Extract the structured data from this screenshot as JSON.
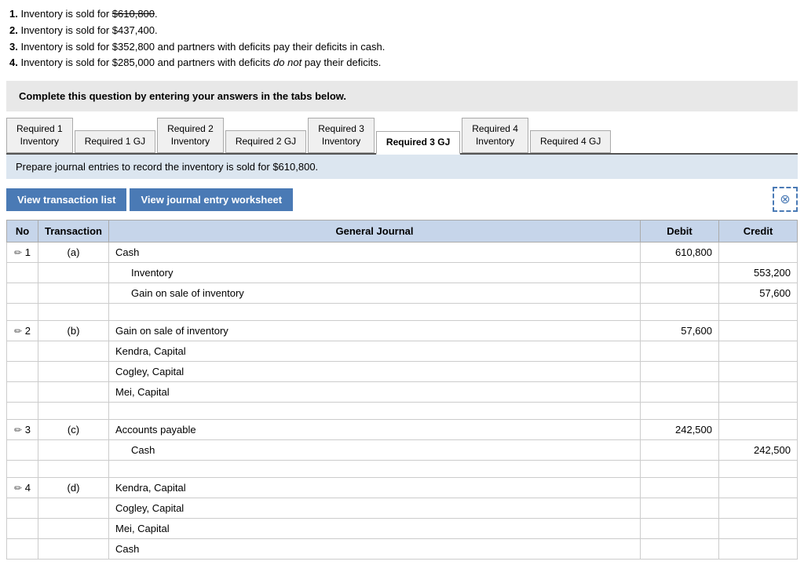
{
  "top_text": {
    "line1": "1. Inventory is sold for $610,800.",
    "line1_strikethrough": "$610,800",
    "line2": "2. Inventory is sold for $437,400.",
    "line3": "3. Inventory is sold for $352,800 and partners with deficits pay their deficits in cash.",
    "line4": "4. Inventory is sold for $285,000 and partners with deficits",
    "line4_italic": "do not",
    "line4_end": "pay their deficits."
  },
  "instruction": "Complete this question by entering your answers in the tabs below.",
  "tabs": [
    {
      "id": "req1inv",
      "label": "Required 1\nInventory",
      "active": false
    },
    {
      "id": "req1gj",
      "label": "Required 1 GJ",
      "active": false
    },
    {
      "id": "req2inv",
      "label": "Required 2\nInventory",
      "active": false
    },
    {
      "id": "req2gj",
      "label": "Required 2 GJ",
      "active": false
    },
    {
      "id": "req3inv",
      "label": "Required 3\nInventory",
      "active": false
    },
    {
      "id": "req3gj",
      "label": "Required 3 GJ",
      "active": true
    },
    {
      "id": "req4inv",
      "label": "Required 4\nInventory",
      "active": false
    },
    {
      "id": "req4gj",
      "label": "Required 4 GJ",
      "active": false
    }
  ],
  "tab_description": "Prepare journal entries to record the inventory is sold for $610,800.",
  "buttons": {
    "view_transaction": "View transaction list",
    "view_journal": "View journal entry worksheet"
  },
  "table": {
    "headers": [
      "No",
      "Transaction",
      "General Journal",
      "Debit",
      "Credit"
    ],
    "rows": [
      {
        "group": 1,
        "no": "1",
        "trans": "(a)",
        "gj": "Cash",
        "debit": "610,800",
        "credit": "",
        "indent": false
      },
      {
        "group": 1,
        "no": "",
        "trans": "",
        "gj": "Inventory",
        "debit": "",
        "credit": "553,200",
        "indent": true
      },
      {
        "group": 1,
        "no": "",
        "trans": "",
        "gj": "Gain on sale of inventory",
        "debit": "",
        "credit": "57,600",
        "indent": true
      },
      {
        "group": 1,
        "no": "",
        "trans": "",
        "gj": "",
        "debit": "",
        "credit": "",
        "indent": false
      },
      {
        "group": 2,
        "no": "2",
        "trans": "(b)",
        "gj": "Gain on sale of inventory",
        "debit": "57,600",
        "credit": "",
        "indent": false
      },
      {
        "group": 2,
        "no": "",
        "trans": "",
        "gj": "Kendra, Capital",
        "debit": "",
        "credit": "",
        "indent": false
      },
      {
        "group": 2,
        "no": "",
        "trans": "",
        "gj": "Cogley, Capital",
        "debit": "",
        "credit": "",
        "indent": false
      },
      {
        "group": 2,
        "no": "",
        "trans": "",
        "gj": "Mei, Capital",
        "debit": "",
        "credit": "",
        "indent": false
      },
      {
        "group": 2,
        "no": "",
        "trans": "",
        "gj": "",
        "debit": "",
        "credit": "",
        "indent": false
      },
      {
        "group": 3,
        "no": "3",
        "trans": "(c)",
        "gj": "Accounts payable",
        "debit": "242,500",
        "credit": "",
        "indent": false
      },
      {
        "group": 3,
        "no": "",
        "trans": "",
        "gj": "Cash",
        "debit": "",
        "credit": "242,500",
        "indent": true
      },
      {
        "group": 3,
        "no": "",
        "trans": "",
        "gj": "",
        "debit": "",
        "credit": "",
        "indent": false
      },
      {
        "group": 4,
        "no": "4",
        "trans": "(d)",
        "gj": "Kendra, Capital",
        "debit": "",
        "credit": "",
        "indent": false
      },
      {
        "group": 4,
        "no": "",
        "trans": "",
        "gj": "Cogley, Capital",
        "debit": "",
        "credit": "",
        "indent": false
      },
      {
        "group": 4,
        "no": "",
        "trans": "",
        "gj": "Mei, Capital",
        "debit": "",
        "credit": "",
        "indent": false
      },
      {
        "group": 4,
        "no": "",
        "trans": "",
        "gj": "Cash",
        "debit": "",
        "credit": "",
        "indent": false
      }
    ]
  }
}
